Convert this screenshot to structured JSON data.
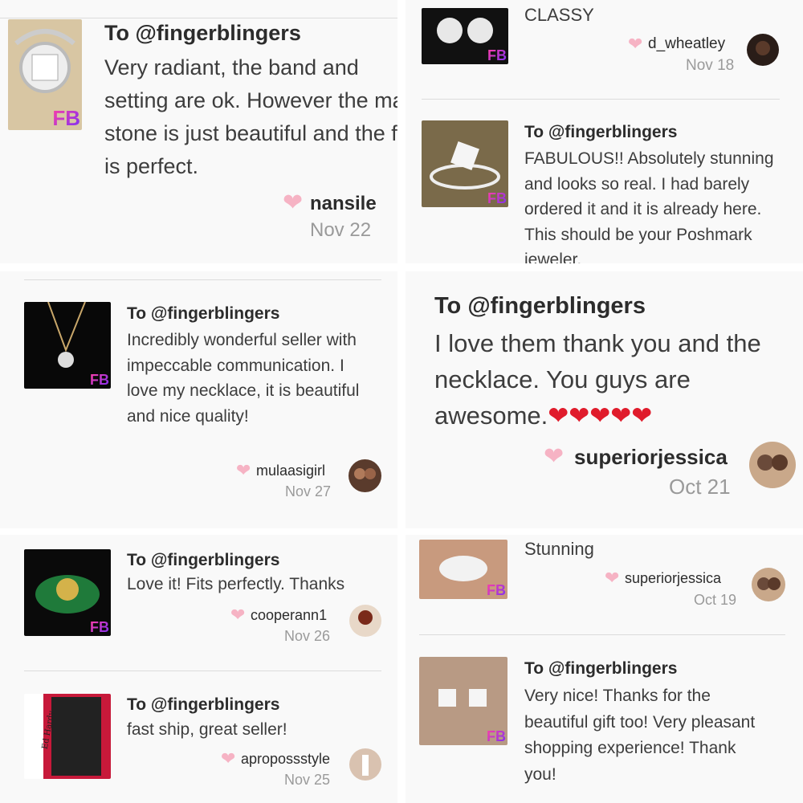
{
  "reviews": [
    {
      "to": "To @fingerblingers",
      "message": "Very radiant, the band and setting are ok. However the main stone is just beautiful and the fit is perfect.",
      "user": "nansile",
      "date": "Nov 22"
    },
    {
      "message": "CLASSY",
      "user": "d_wheatley",
      "date": "Nov 18"
    },
    {
      "to": "To @fingerblingers",
      "message": "FABULOUS!! Absolutely stunning and looks so real. I had barely ordered it and it is already here. This should be your Poshmark jeweler."
    },
    {
      "to": "To @fingerblingers",
      "message": "Incredibly wonderful seller with impeccable communication. I love my necklace, it is beautiful and nice quality!",
      "user": "mulaasigirl",
      "date": "Nov 27"
    },
    {
      "to": "To @fingerblingers",
      "message": "I love them thank you and the necklace. You guys are awesome.",
      "hearts": "❤❤❤❤❤",
      "user": "superiorjessica",
      "date": "Oct 21"
    },
    {
      "to": "To @fingerblingers",
      "message": "Love it! Fits perfectly. Thanks",
      "user": "cooperann1",
      "date": "Nov 26"
    },
    {
      "to": "To @fingerblingers",
      "message": "fast ship, great seller!",
      "user": "apropossstyle",
      "date": "Nov 25"
    },
    {
      "message": "Stunning",
      "user": "superiorjessica",
      "date": "Oct 19"
    },
    {
      "to": "To @fingerblingers",
      "message": "Very nice! Thanks for the beautiful gift too! Very pleasant shopping experience! Thank you!"
    }
  ],
  "badge": "FB",
  "colors": {
    "heart": "#f6b3c4",
    "text": "#2c2c2c",
    "muted": "#9a9a9a",
    "panel": "#f9f9f9"
  }
}
